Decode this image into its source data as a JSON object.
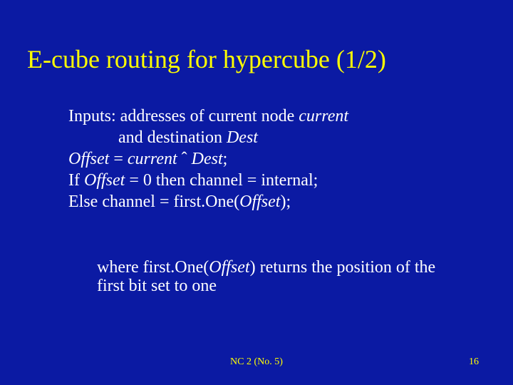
{
  "title": "E-cube routing for hypercube (1/2)",
  "body": {
    "l1a": "Inputs: addresses of current node ",
    "l1b": "current",
    "l2a": "and destination ",
    "l2b": "Dest",
    "l3a": "Offset",
    "l3b": " = ",
    "l3c": "current",
    "l3d": " ˆ ",
    "l3e": "Dest",
    "l3f": ";",
    "l4a": "If ",
    "l4b": "Offset",
    "l4c": " = 0 then channel = internal;",
    "l5a": "Else  channel = first.One(",
    "l5b": "Offset",
    "l5c": ");"
  },
  "expl": {
    "a": "where first.One(",
    "b": "Offset",
    "c": ") returns the position of the first bit set to one"
  },
  "footer": {
    "center": "NC 2 (No. 5)",
    "page": "16"
  }
}
